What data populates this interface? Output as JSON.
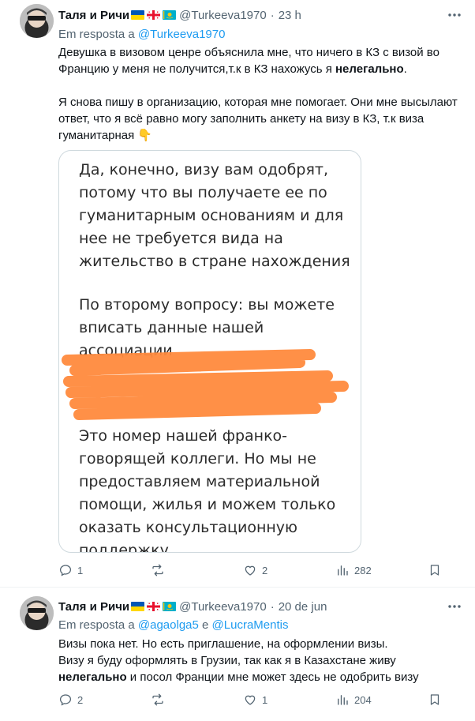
{
  "tweets": [
    {
      "author_name": "Таля и Ричи",
      "handle": "@Turkeeva1970",
      "separator": "·",
      "time": "23 h",
      "reply_prefix": "Em resposta a",
      "reply_to": "@Turkeeva1970",
      "p1_before": "Девушка в визовом ценре объяснила мне, что ничего в КЗ с визой во Францию у меня не получится,т.к в КЗ нахожусь я ",
      "p1_bold": "нелегально",
      "p1_after": ".",
      "p2": "Я снова пишу в организацию,  которая мне помогает. Они мне высылают ответ, что я всё равно могу заполнить анкету на визу в КЗ, т.к виза гуманитарная 👇",
      "media": {
        "block1": "Да, конечно, визу вам одобрят, потому что вы получаете ее по гуманитарным основаниям и для нее не требуется вида на жительство в стране нахождения",
        "block2": "По второму вопросу: вы можете вписать данные нашей ассоциации",
        "block3": "Это номер нашей франко-говорящей коллеги. Но мы не предоставляем материальной помощи, жилья и можем только оказать консультационную поддержку"
      },
      "replies": "1",
      "reposts": "",
      "likes": "2",
      "views": "282"
    },
    {
      "author_name": "Таля и Ричи",
      "handle": "@Turkeeva1970",
      "separator": "·",
      "time": "20 de jun",
      "reply_prefix": "Em resposta a",
      "reply_to_1": "@agaolga5",
      "reply_conj": "e",
      "reply_to_2": "@LucraMentis",
      "p1_a": "Визы пока нет. Но есть приглашение,  на оформлении визы.",
      "p1_b_before": "Визу я буду оформлять в Грузии,  так как я в Казахстане живу ",
      "p1_b_bold": "нелегально",
      "p1_b_after": " и посол Франции мне может здесь не одобрить визу",
      "replies": "2",
      "reposts": "",
      "likes": "1",
      "views": "204"
    }
  ],
  "icons": [
    "avatar",
    "flag-ukraine",
    "flag-georgia",
    "flag-kazakhstan",
    "more-icon",
    "reply-icon",
    "repost-icon",
    "like-icon",
    "views-icon",
    "bookmark-icon",
    "point-down-emoji"
  ],
  "colors": {
    "text": "#0f1419",
    "secondary": "#536471",
    "link": "#1d9bf0",
    "redaction": "#ff8a3d"
  }
}
